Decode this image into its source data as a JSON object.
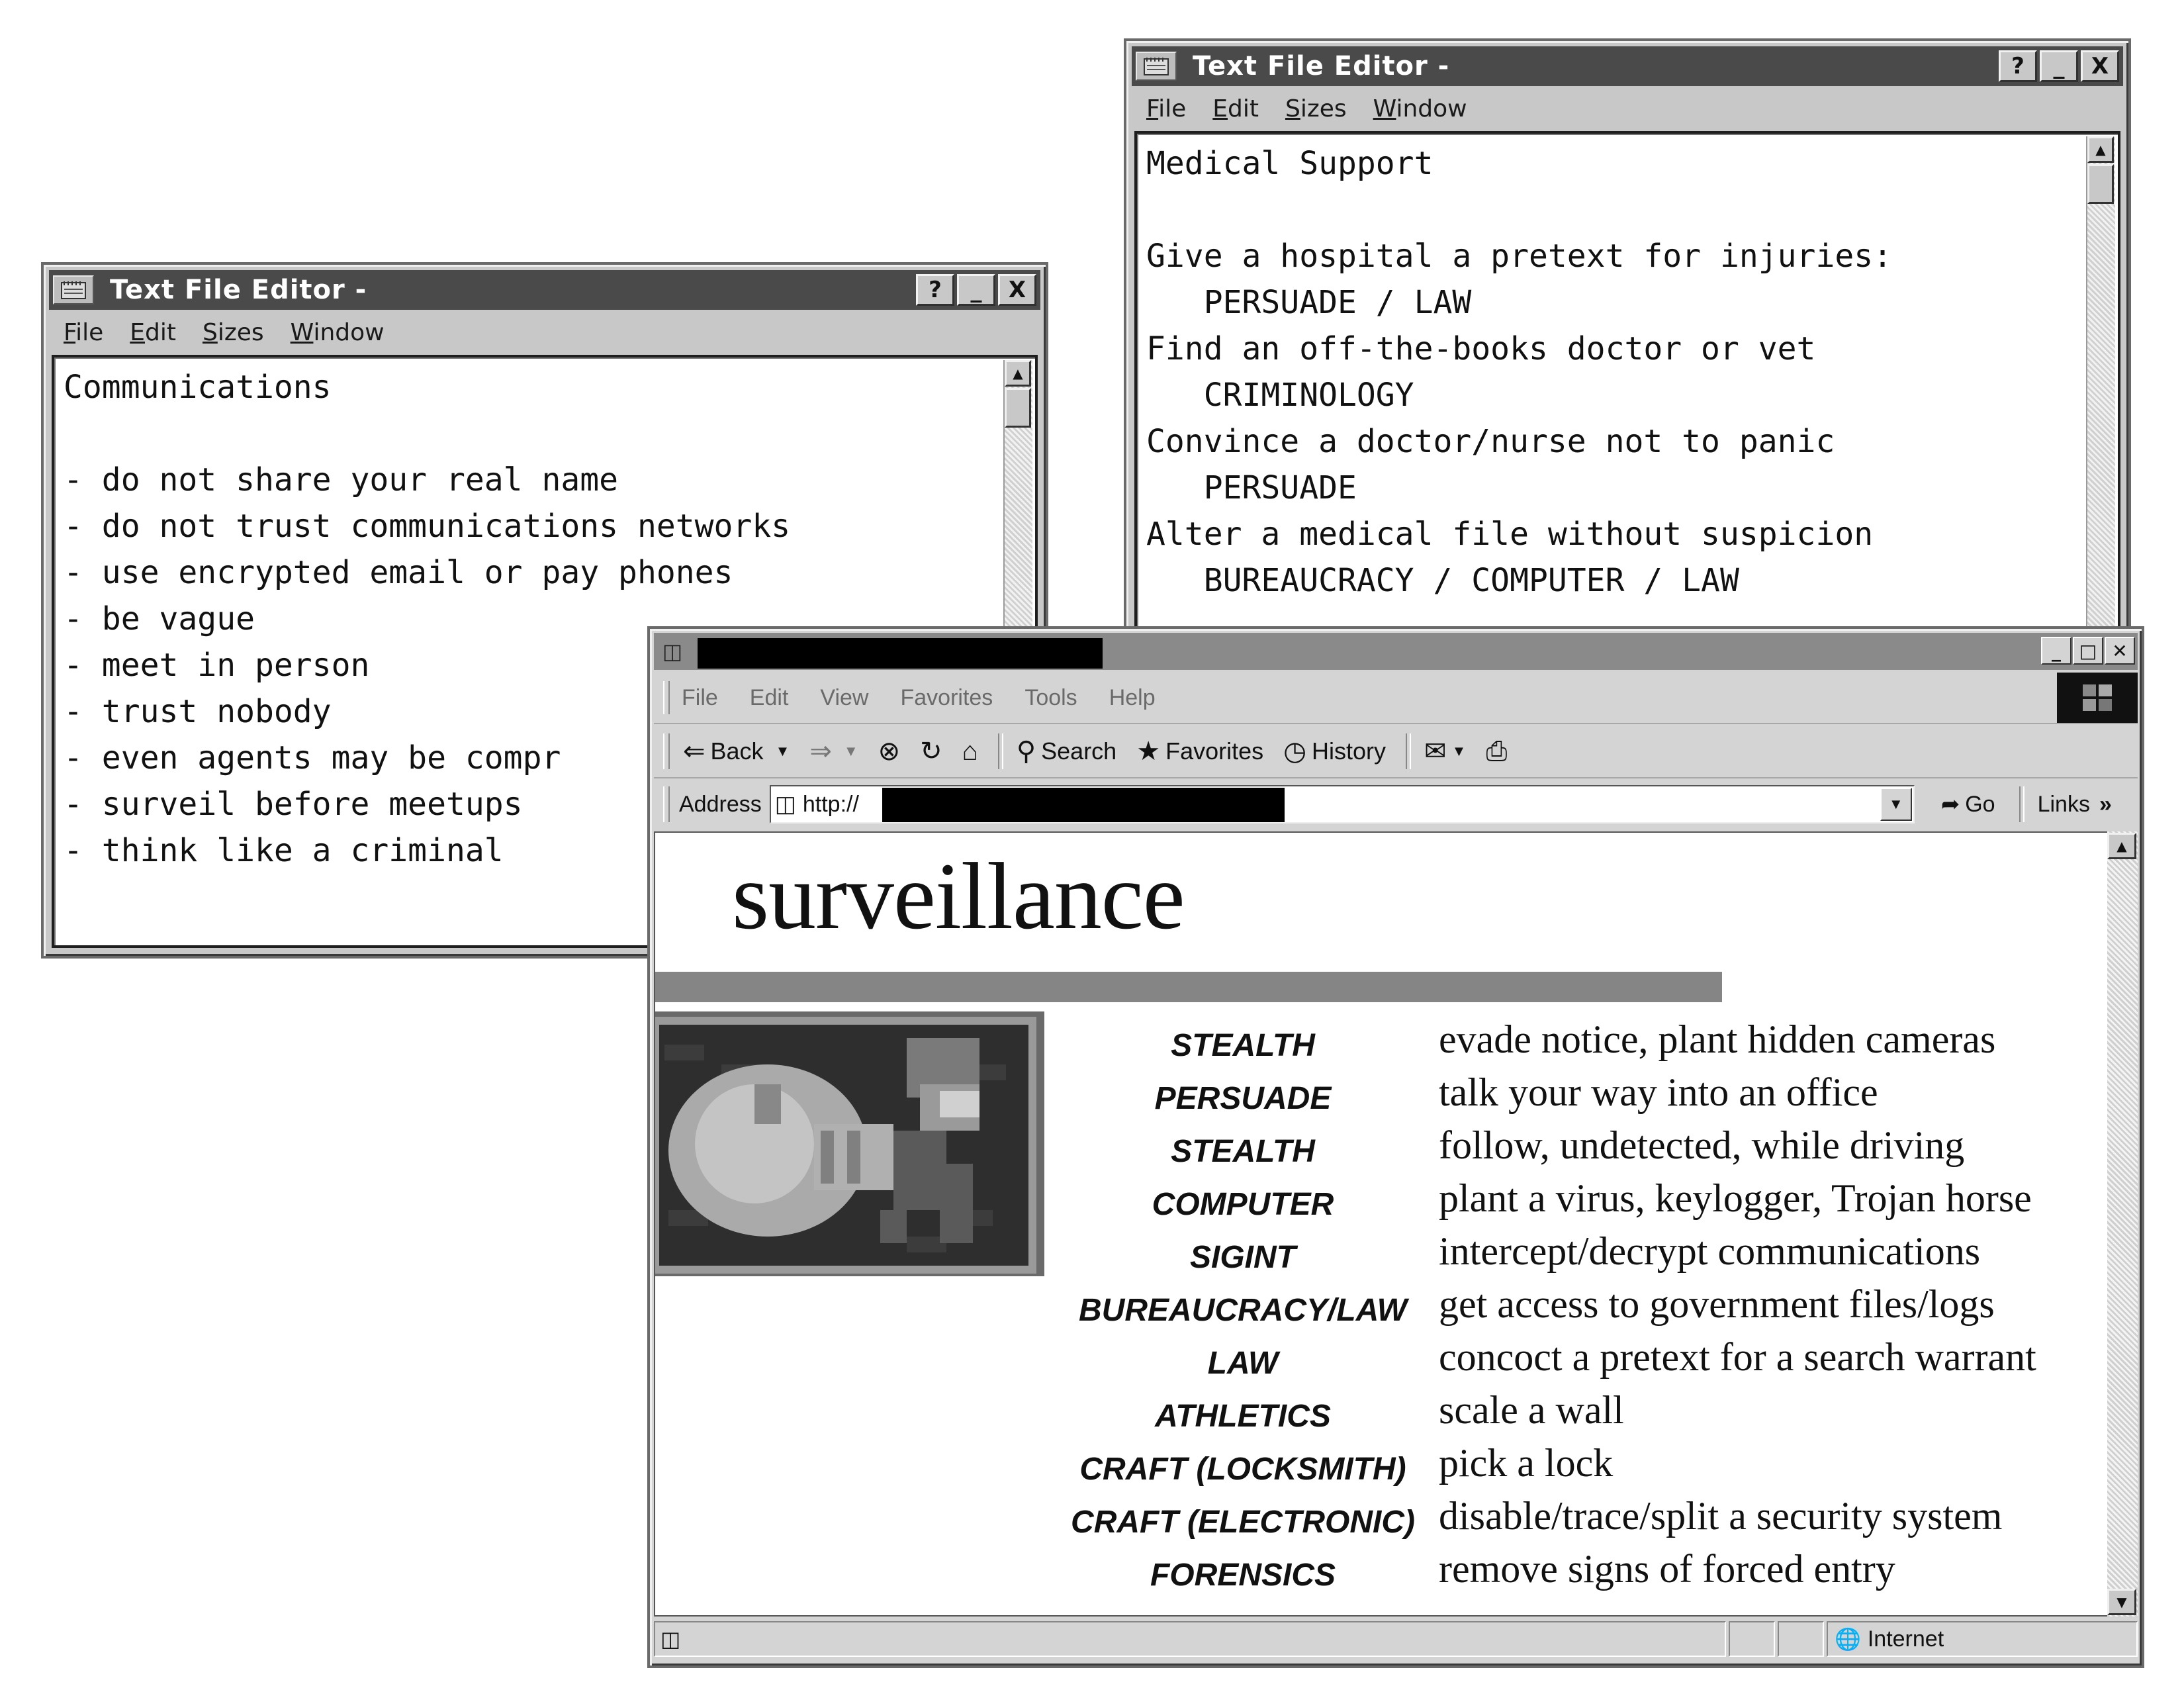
{
  "editor_left": {
    "title": "Text File Editor -",
    "menu": [
      "File",
      "Edit",
      "Sizes",
      "Window"
    ],
    "buttons": [
      "?",
      "_",
      "X"
    ],
    "lines": [
      "Communications",
      "",
      "- do not share your real name",
      "- do not trust communications networks",
      "- use encrypted email or pay phones",
      "- be vague",
      "- meet in person",
      "- trust nobody",
      "- even agents may be compr",
      "- surveil before meetups",
      "- think like a criminal"
    ]
  },
  "editor_right": {
    "title": "Text File Editor -",
    "menu": [
      "File",
      "Edit",
      "Sizes",
      "Window"
    ],
    "buttons": [
      "?",
      "_",
      "X"
    ],
    "lines": [
      "Medical Support",
      "",
      "Give a hospital a pretext for injuries:",
      "   PERSUADE / LAW",
      "Find an off-the-books doctor or vet",
      "   CRIMINOLOGY",
      "Convince a doctor/nurse not to panic",
      "   PERSUADE",
      "Alter a medical file without suspicion",
      "   BUREAUCRACY / COMPUTER / LAW"
    ]
  },
  "browser": {
    "menu": [
      "File",
      "Edit",
      "View",
      "Favorites",
      "Tools",
      "Help"
    ],
    "toolbar": {
      "back": "Back",
      "search": "Search",
      "favorites": "Favorites",
      "history": "History"
    },
    "address_label": "Address",
    "address_value": "http://",
    "go_label": "Go",
    "links_label": "Links",
    "links_chevron": "»",
    "page": {
      "heading": "surveillance",
      "rows": [
        {
          "skill": "STEALTH",
          "desc": "evade notice, plant hidden cameras"
        },
        {
          "skill": "PERSUADE",
          "desc": "talk your way into an office"
        },
        {
          "skill": "STEALTH",
          "desc": "follow, undetected, while driving"
        },
        {
          "skill": "COMPUTER",
          "desc": "plant a virus, keylogger, Trojan horse"
        },
        {
          "skill": "SIGINT",
          "desc": "intercept/decrypt communications"
        },
        {
          "skill": "BUREAUCRACY/LAW",
          "desc": "get access to government files/logs"
        },
        {
          "skill": "LAW",
          "desc": "concoct a pretext for a search warrant"
        },
        {
          "skill": "ATHLETICS",
          "desc": "scale a wall"
        },
        {
          "skill": "CRAFT (LOCKSMITH)",
          "desc": "pick a lock"
        },
        {
          "skill": "CRAFT (ELECTRONIC)",
          "desc": "disable/trace/split a security system"
        },
        {
          "skill": "FORENSICS",
          "desc": "remove signs of forced entry"
        }
      ]
    },
    "status_zone": "Internet"
  },
  "icons": {
    "editor_app": "notepad-icon",
    "ie_page": "ie-page-icon",
    "globe": "internet-zone-icon"
  }
}
